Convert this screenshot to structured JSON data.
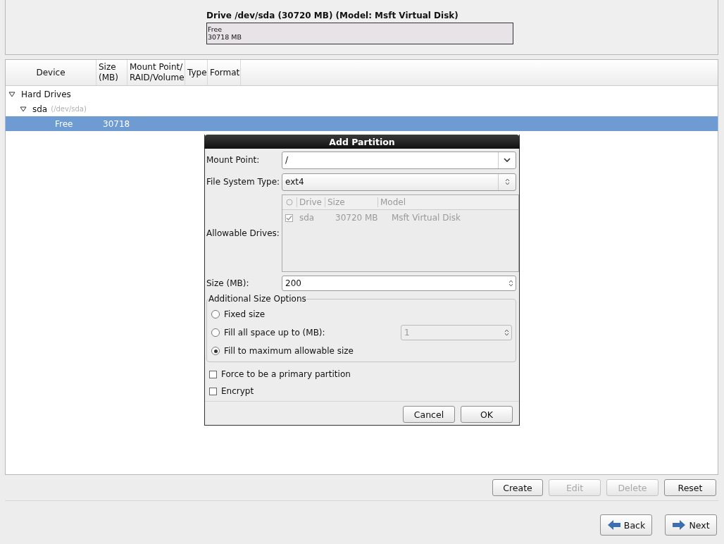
{
  "drive_summary": {
    "title": "Drive /dev/sda (30720 MB) (Model: Msft Virtual Disk)",
    "segments": [
      {
        "label": "Free",
        "size": "30718 MB",
        "selected": false
      }
    ]
  },
  "device_table": {
    "columns": [
      "Device",
      "Size\n(MB)",
      "Mount Point/\nRAID/Volume",
      "Type",
      "Format"
    ],
    "rows": [
      {
        "device": "Hard Drives",
        "expanded": true,
        "children": [
          {
            "device": "sda",
            "path": "(/dev/sda)",
            "expanded": true,
            "children": [
              {
                "device": "Free",
                "size": "30718",
                "selected": true
              }
            ]
          }
        ]
      }
    ]
  },
  "dialog": {
    "title": "Add Partition",
    "mount_point": {
      "label": "Mount Point:",
      "value": "/"
    },
    "file_system_type": {
      "label": "File System Type:",
      "value": "ext4"
    },
    "allowable_drives": {
      "label": "Allowable Drives:",
      "columns": [
        "Drive",
        "Size",
        "Model"
      ],
      "rows": [
        {
          "drive": "sda",
          "size": "30720 MB",
          "model": "Msft Virtual Disk",
          "checked": true
        }
      ]
    },
    "size": {
      "label": "Size (MB):",
      "value": "200"
    },
    "size_options": {
      "title": "Additional Size Options",
      "options": [
        {
          "label": "Fixed size",
          "selected": false
        },
        {
          "label": "Fill all space up to (MB):",
          "selected": false,
          "value": "1"
        },
        {
          "label": "Fill to maximum allowable size",
          "selected": true
        }
      ]
    },
    "checkboxes": [
      {
        "label": "Force to be a primary partition",
        "checked": false
      },
      {
        "label": "Encrypt",
        "checked": false
      }
    ],
    "buttons": [
      "Cancel",
      "OK"
    ]
  },
  "actions": [
    {
      "label": "Create",
      "disabled": false
    },
    {
      "label": "Edit",
      "disabled": true
    },
    {
      "label": "Delete",
      "disabled": true
    },
    {
      "label": "Reset",
      "disabled": false
    }
  ],
  "navigation": [
    {
      "label": "Back",
      "kind": "back"
    },
    {
      "label": "Next",
      "kind": "next"
    }
  ]
}
